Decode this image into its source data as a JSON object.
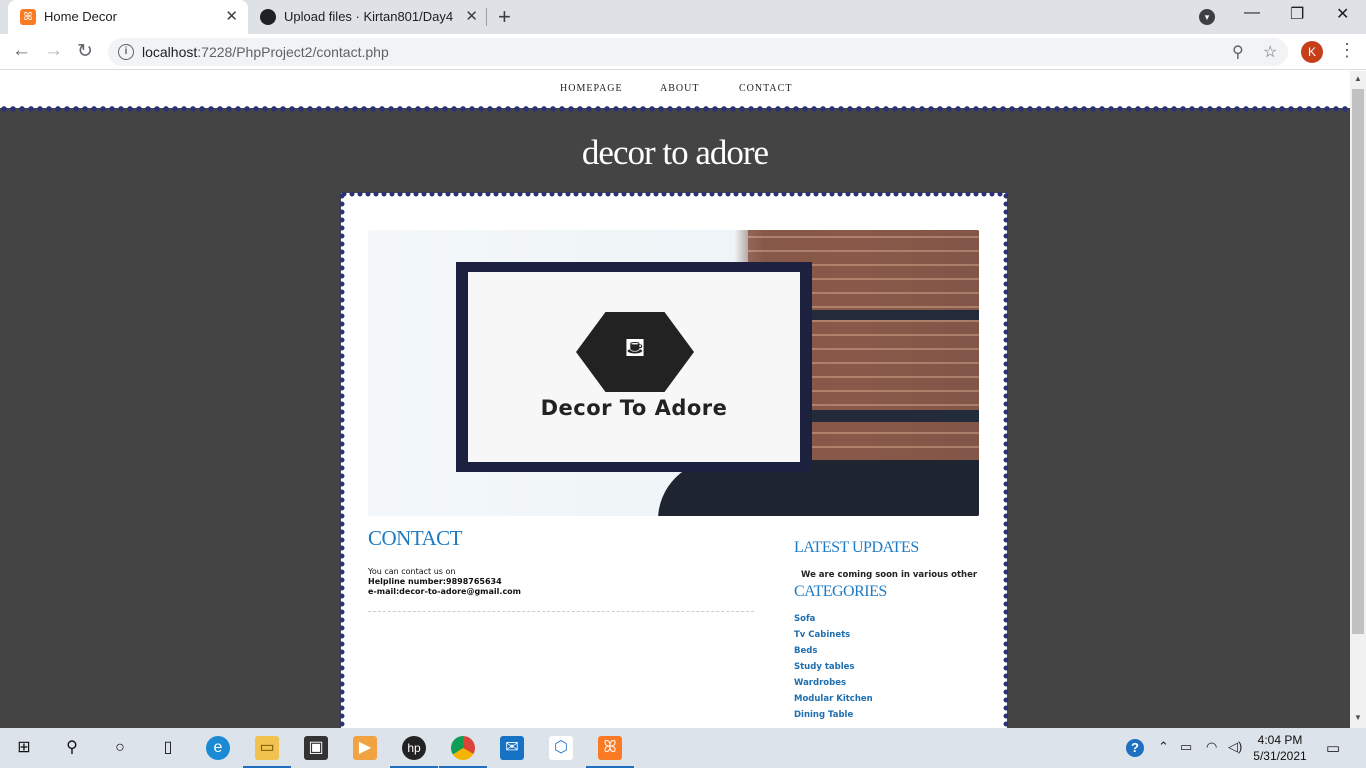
{
  "browser": {
    "tabs": [
      {
        "title": "Home Decor",
        "favicon": "xampp-icon",
        "active": true
      },
      {
        "title": "Upload files · Kirtan801/Day4",
        "favicon": "github-icon",
        "active": false
      }
    ],
    "url_host": "localhost",
    "url_rest": ":7228/PhpProject2/contact.php",
    "profile_initial": "K"
  },
  "site": {
    "nav": [
      "HOMEPAGE",
      "ABOUT",
      "CONTACT"
    ],
    "title": "decor to adore",
    "banner_text": "Decor To Adore",
    "contact": {
      "heading": "CONTACT",
      "line1": "You can contact us on",
      "helpline": "Helpline number:9898765634",
      "email": "e-mail:decor-to-adore@gmail.com"
    },
    "latest_updates": {
      "heading": "LATEST UPDATES",
      "text": "We are coming soon in various other cities"
    },
    "categories": {
      "heading": "CATEGORIES",
      "items": [
        "Sofa",
        "Tv Cabinets",
        "Beds",
        "Study tables",
        "Wardrobes",
        "Modular Kitchen",
        "Dining Table"
      ]
    }
  },
  "taskbar": {
    "time": "4:04 PM",
    "date": "5/31/2021"
  },
  "colors": {
    "accent_blue": "#1e7bc3",
    "page_background": "#444444",
    "scallop": "#2d3277"
  }
}
